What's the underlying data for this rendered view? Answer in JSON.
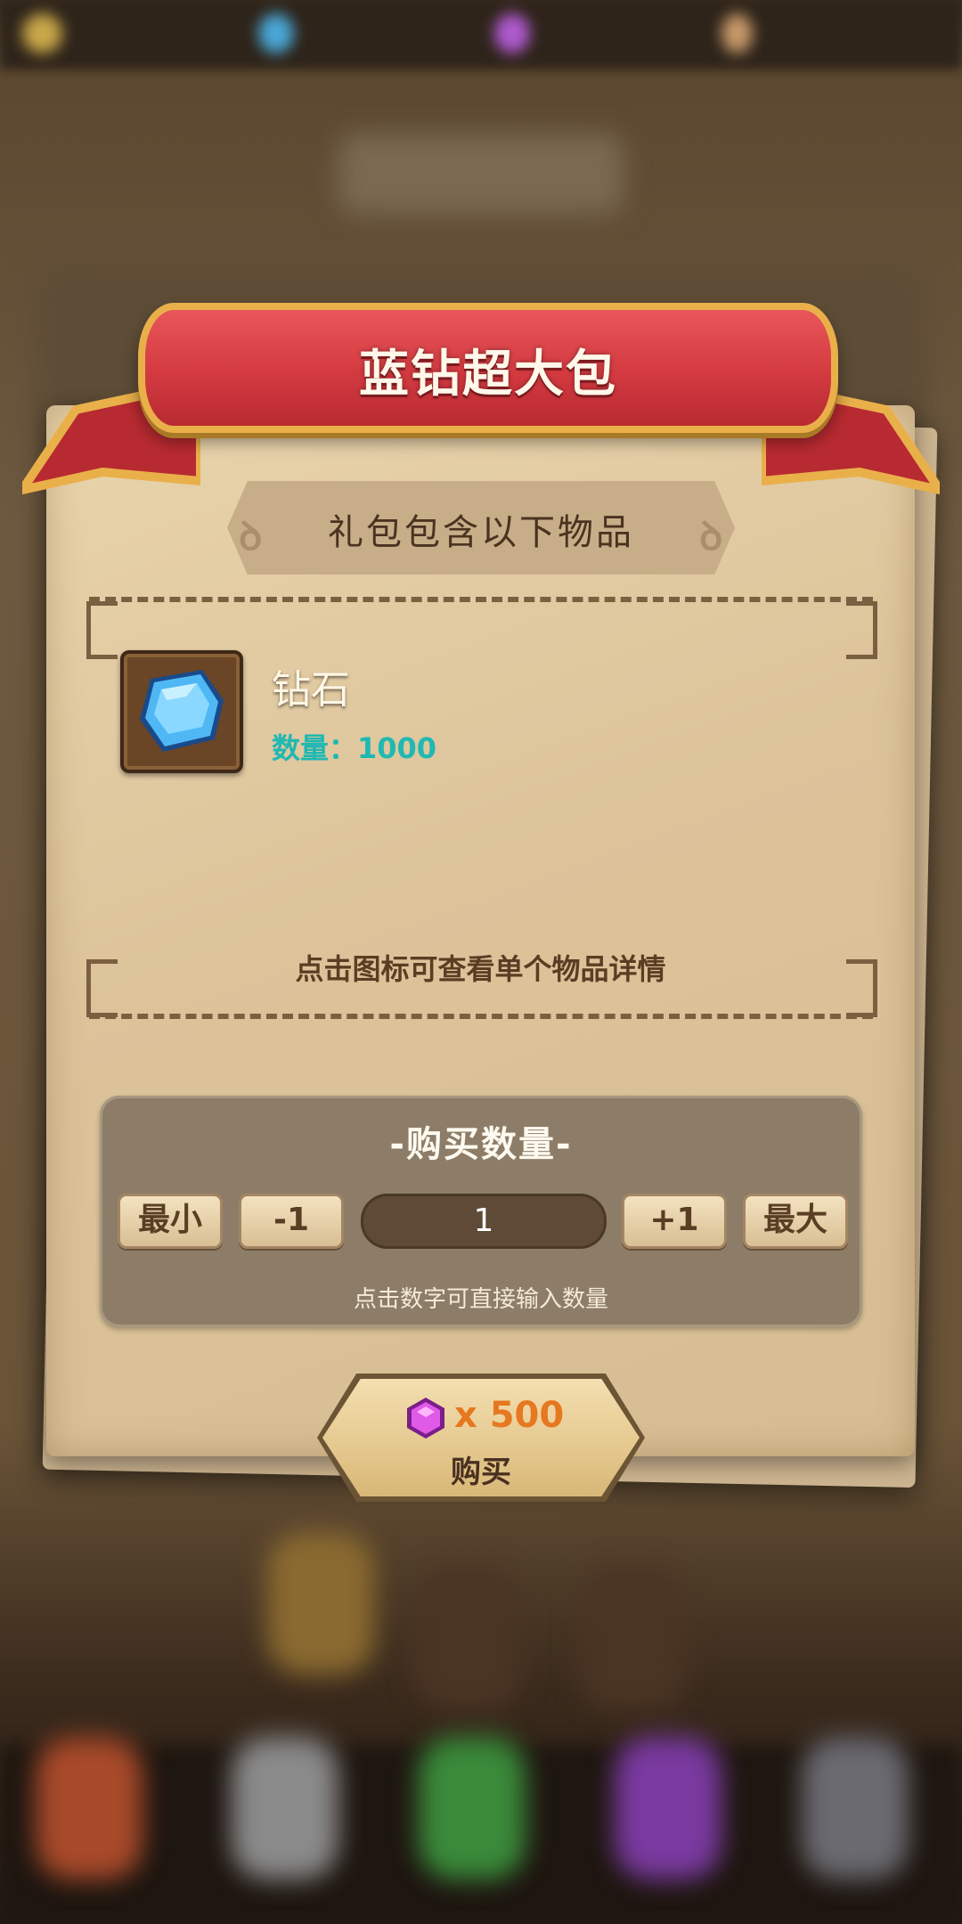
{
  "dialog": {
    "title": "蓝钻超大包",
    "subtitle": "礼包包含以下物品",
    "hint": "点击图标可查看单个物品详情"
  },
  "items": [
    {
      "name": "钻石",
      "quantity_label": "数量：1000",
      "icon": "blue-diamond-icon"
    }
  ],
  "quantity": {
    "title": "-购买数量-",
    "min_label": "最小",
    "minus_label": "-1",
    "value": "1",
    "plus_label": "+1",
    "max_label": "最大",
    "hint": "点击数字可直接输入数量"
  },
  "buy": {
    "price": "x 500",
    "label": "购买",
    "currency_icon": "purple-gem-icon"
  },
  "colors": {
    "ribbon": "#d33a40",
    "ribbon_trim": "#e9b04a",
    "paper": "#dcc39a",
    "quantity_text": "#1fb8b2",
    "price_text": "#e67820"
  }
}
